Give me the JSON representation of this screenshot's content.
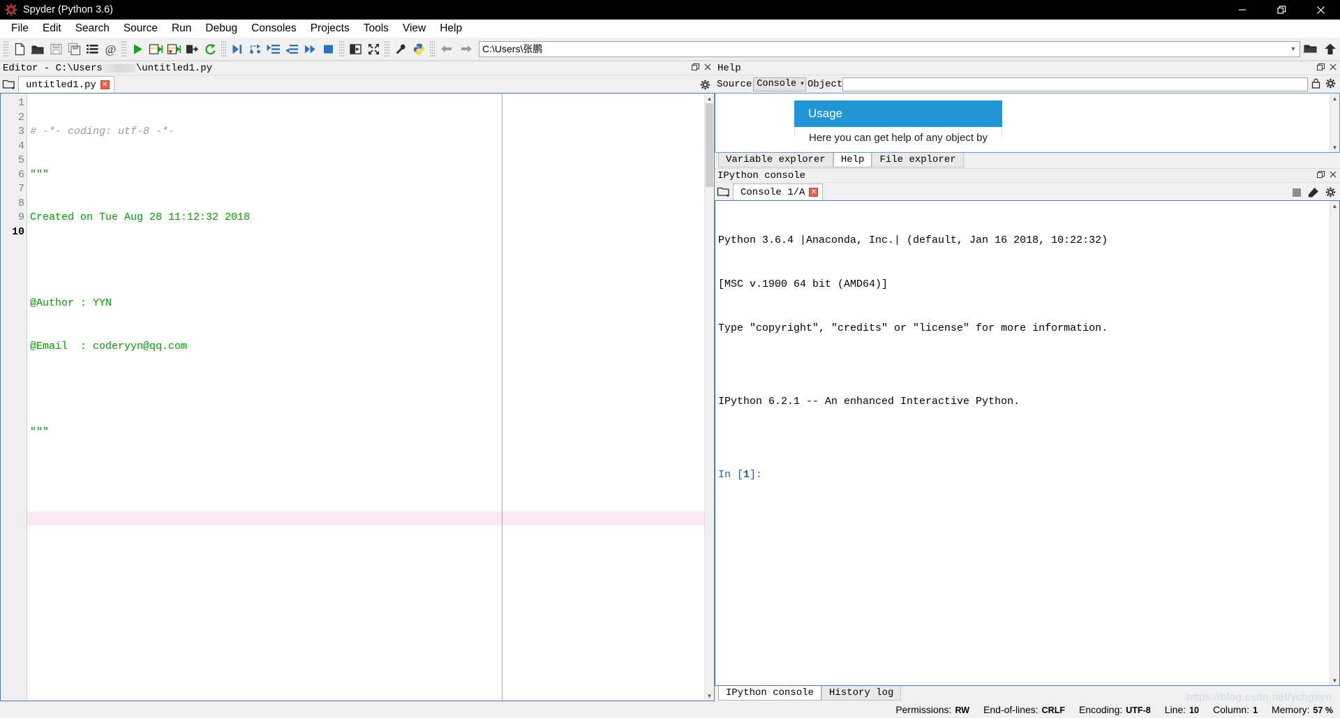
{
  "window": {
    "title": "Spyder (Python 3.6)",
    "logo_icon": "spyder-logo-icon",
    "minimize_label": "—",
    "maximize_label": "❐",
    "close_label": "✕"
  },
  "menubar": {
    "items": [
      {
        "label": "File",
        "name": "menu-file"
      },
      {
        "label": "Edit",
        "name": "menu-edit"
      },
      {
        "label": "Search",
        "name": "menu-search"
      },
      {
        "label": "Source",
        "name": "menu-source"
      },
      {
        "label": "Run",
        "name": "menu-run"
      },
      {
        "label": "Debug",
        "name": "menu-debug"
      },
      {
        "label": "Consoles",
        "name": "menu-consoles"
      },
      {
        "label": "Projects",
        "name": "menu-projects"
      },
      {
        "label": "Tools",
        "name": "menu-tools"
      },
      {
        "label": "View",
        "name": "menu-view"
      },
      {
        "label": "Help",
        "name": "menu-help"
      }
    ]
  },
  "toolbar": {
    "icons": [
      "new-file-icon",
      "open-file-icon",
      "save-file-icon",
      "save-all-icon",
      "file-list-icon",
      "at-sign-icon",
      "run-file-icon",
      "run-cell-icon",
      "run-cell-advance-icon",
      "run-selection-icon",
      "re-run-cell-icon",
      "debug-file-icon",
      "debug-step-over-icon",
      "debug-step-into-icon",
      "debug-step-return-icon",
      "debug-continue-icon",
      "debug-stop-icon",
      "maximize-pane-icon",
      "fullscreen-icon",
      "preferences-icon",
      "pythonpath-manager-icon"
    ],
    "back_icon": "back-arrow-icon",
    "forward_icon": "forward-arrow-icon",
    "open_dir_icon": "open-directory-icon",
    "parent_dir_icon": "parent-directory-icon"
  },
  "pathbar": {
    "value": "C:\\Users\\张鹏",
    "dropdown_icon": "chevron-down-icon"
  },
  "editor": {
    "panel_title_prefix": "Editor - C:\\Users",
    "panel_title_suffix": "\\untitled1.py",
    "undock_icon": "undock-icon",
    "close_icon": "close-icon",
    "browse_tabs_icon": "browse-tabs-icon",
    "options_icon": "options-gear-icon",
    "tab": {
      "label": "untitled1.py",
      "close_label": "✕"
    },
    "current_line": 10,
    "lines": [
      {
        "n": 1,
        "text": "# -*- coding: utf-8 -*-",
        "style": "comment"
      },
      {
        "n": 2,
        "text": "\"\"\"",
        "style": "string"
      },
      {
        "n": 3,
        "text": "Created on Tue Aug 28 11:12:32 2018",
        "style": "string"
      },
      {
        "n": 4,
        "text": "",
        "style": "string"
      },
      {
        "n": 5,
        "text": "@Author : YYN",
        "style": "string"
      },
      {
        "n": 6,
        "text": "@Email  : coderyyn@qq.com",
        "style": "string"
      },
      {
        "n": 7,
        "text": "",
        "style": "string"
      },
      {
        "n": 8,
        "text": "\"\"\"",
        "style": "string"
      },
      {
        "n": 9,
        "text": "",
        "style": "plain"
      },
      {
        "n": 10,
        "text": "",
        "style": "plain"
      }
    ]
  },
  "help": {
    "panel_title": "Help",
    "undock_icon": "undock-icon",
    "close_icon": "close-icon",
    "options_icon": "options-gear-icon",
    "source_label": "Source",
    "source_value": "Console",
    "source_caret": "▼",
    "object_label": "Object",
    "object_value": "",
    "lock_icon": "lock-icon",
    "gear_icon": "options-gear-icon",
    "usage_heading": "Usage",
    "usage_text": "Here you can get help of any object by",
    "tabs": [
      {
        "label": "Variable explorer",
        "active": false,
        "name": "tab-variable-explorer"
      },
      {
        "label": "Help",
        "active": true,
        "name": "tab-help"
      },
      {
        "label": "File explorer",
        "active": false,
        "name": "tab-file-explorer"
      }
    ]
  },
  "console": {
    "panel_title": "IPython console",
    "undock_icon": "undock-icon",
    "close_icon": "close-icon",
    "browse_tabs_icon": "browse-tabs-icon",
    "stop_icon": "interrupt-kernel-icon",
    "clear_icon": "remove-all-variables-icon",
    "options_icon": "options-gear-icon",
    "tab": {
      "label": "Console 1/A",
      "close_label": "✕"
    },
    "output": [
      "Python 3.6.4 |Anaconda, Inc.| (default, Jan 16 2018, 10:22:32)",
      "[MSC v.1900 64 bit (AMD64)]",
      "Type \"copyright\", \"credits\" or \"license\" for more information.",
      "",
      "IPython 6.2.1 -- An enhanced Interactive Python.",
      ""
    ],
    "prompt_prefix": "In [",
    "prompt_number": "1",
    "prompt_suffix": "]:",
    "tabs": [
      {
        "label": "IPython console",
        "active": true,
        "name": "tab-ipython-console"
      },
      {
        "label": "History log",
        "active": false,
        "name": "tab-history-log"
      }
    ]
  },
  "statusbar": {
    "permissions_key": "Permissions:",
    "permissions_value": "RW",
    "eol_key": "End-of-lines:",
    "eol_value": "CRLF",
    "encoding_key": "Encoding:",
    "encoding_value": "UTF-8",
    "line_key": "Line:",
    "line_value": "10",
    "column_key": "Column:",
    "column_value": "1",
    "memory_key": "Memory:",
    "memory_value": "57 %",
    "watermark": "https://blog.csdn.net/ychgsyn"
  },
  "colors": {
    "accent_blue": "#2196d6",
    "pane_border": "#4a7ebb",
    "string_green": "#00a000",
    "comment_gray": "#999999",
    "current_line": "#fbe8f5",
    "titlebar_bg": "#000000"
  }
}
